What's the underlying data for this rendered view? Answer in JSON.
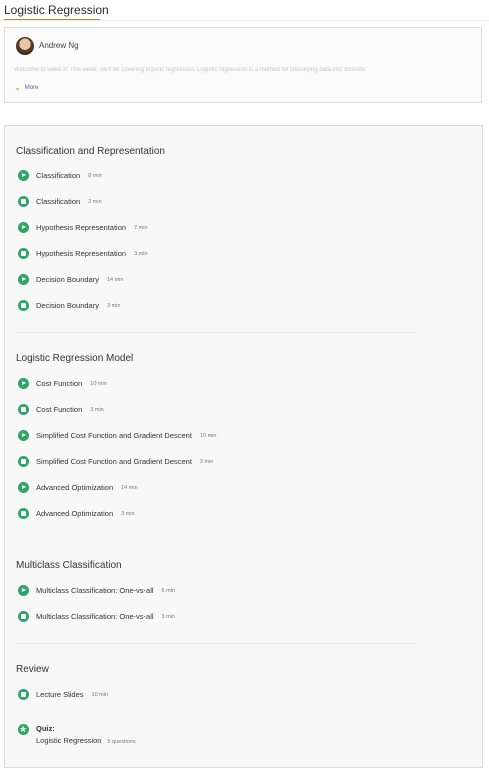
{
  "tab": {
    "title": "Logistic Regression"
  },
  "intro": {
    "author": "Andrew Ng",
    "text": "Welcome to week 3! This week, we'll be covering logistic regression. Logistic regression is a method for classifying data into discrete",
    "more_label": "More"
  },
  "sections": [
    {
      "title": "Classification and Representation",
      "items": [
        {
          "type": "video",
          "label": "Classification",
          "meta": "8 min"
        },
        {
          "type": "reading",
          "label": "Classification",
          "meta": "2 min"
        },
        {
          "type": "video",
          "label": "Hypothesis Representation",
          "meta": "7 min"
        },
        {
          "type": "reading",
          "label": "Hypothesis Representation",
          "meta": "3 min"
        },
        {
          "type": "video",
          "label": "Decision Boundary",
          "meta": "14 min"
        },
        {
          "type": "reading",
          "label": "Decision Boundary",
          "meta": "3 min"
        }
      ]
    },
    {
      "title": "Logistic Regression Model",
      "items": [
        {
          "type": "video",
          "label": "Cost Function",
          "meta": "10 min"
        },
        {
          "type": "reading",
          "label": "Cost Function",
          "meta": "3 min"
        },
        {
          "type": "video",
          "label": "Simplified Cost Function and Gradient Descent",
          "meta": "10 min"
        },
        {
          "type": "reading",
          "label": "Simplified Cost Function and Gradient Descent",
          "meta": "3 min"
        },
        {
          "type": "video",
          "label": "Advanced Optimization",
          "meta": "14 min"
        },
        {
          "type": "reading",
          "label": "Advanced Optimization",
          "meta": "3 min"
        }
      ]
    },
    {
      "title": "Multiclass Classification",
      "items": [
        {
          "type": "video",
          "label": "Multiclass Classification: One-vs-all",
          "meta": "6 min"
        },
        {
          "type": "reading",
          "label": "Multiclass Classification: One-vs-all",
          "meta": "3 min"
        }
      ]
    },
    {
      "title": "Review",
      "items": [
        {
          "type": "reading",
          "label": "Lecture Slides",
          "meta": "10 min"
        }
      ],
      "quiz": {
        "heading": "Quiz:",
        "label": "Logistic Regression",
        "meta": "5 questions"
      }
    }
  ],
  "colors": {
    "accent": "#2fa566",
    "tab_underline": "#b08f3a"
  },
  "icons": {
    "video": "play-circle-icon",
    "reading": "reading-icon",
    "quiz": "star-circle-icon",
    "more": "chevron-down-icon"
  }
}
